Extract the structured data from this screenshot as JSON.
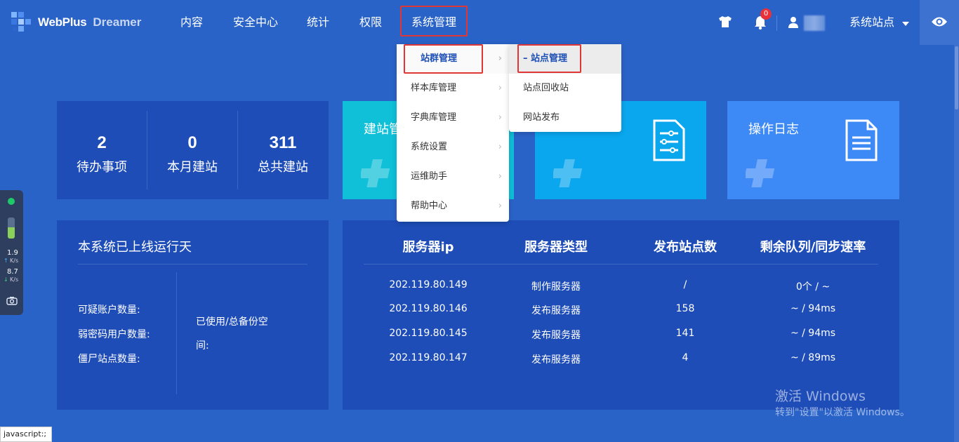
{
  "brand": {
    "name": "WebPlus",
    "sub": "Dreamer"
  },
  "nav": [
    "内容",
    "安全中心",
    "统计",
    "权限",
    "系统管理"
  ],
  "header": {
    "notification_count": "0",
    "site_selector": "系统站点"
  },
  "stats": [
    {
      "value": "2",
      "label": "待办事项"
    },
    {
      "value": "0",
      "label": "本月建站"
    },
    {
      "value": "311",
      "label": "总共建站"
    }
  ],
  "tiles": {
    "t1": "建站管",
    "t4": "操作日志"
  },
  "run": {
    "title": "本系统已上线运行天",
    "labels": [
      "可疑账户数量:",
      "弱密码用户数量:",
      "僵尸站点数量:"
    ],
    "usage_line1": "已使用/总备份空",
    "usage_line2": "间:"
  },
  "servers": {
    "headers": [
      "服务器ip",
      "服务器类型",
      "发布站点数",
      "剩余队列/同步速率"
    ],
    "rows": [
      [
        "202.119.80.149",
        "制作服务器",
        "/",
        "0个 / ~"
      ],
      [
        "202.119.80.146",
        "发布服务器",
        "158",
        "~ / 94ms"
      ],
      [
        "202.119.80.145",
        "发布服务器",
        "141",
        "~ / 94ms"
      ],
      [
        "202.119.80.147",
        "发布服务器",
        "4",
        "~ / 89ms"
      ]
    ]
  },
  "menu_system": [
    "站群管理",
    "样本库管理",
    "字典库管理",
    "系统设置",
    "运维助手",
    "帮助中心"
  ],
  "menu_cluster": [
    "站点管理",
    "站点回收站",
    "网站发布"
  ],
  "float_widget": {
    "up": "1.9",
    "up_unit": "K/s",
    "down": "8.7",
    "down_unit": "K/s"
  },
  "status_bar": "javascript:;",
  "watermark": {
    "line1": "激活 Windows",
    "line2": "转到\"设置\"以激活 Windows。"
  },
  "colors": {
    "bg": "#2a63c8",
    "card": "#1e4db8",
    "tile_cyan": "#0fc0d8",
    "tile_blue": "#0aa7ef",
    "tile_light": "#3d8af7",
    "highlight_red": "#e13636"
  }
}
